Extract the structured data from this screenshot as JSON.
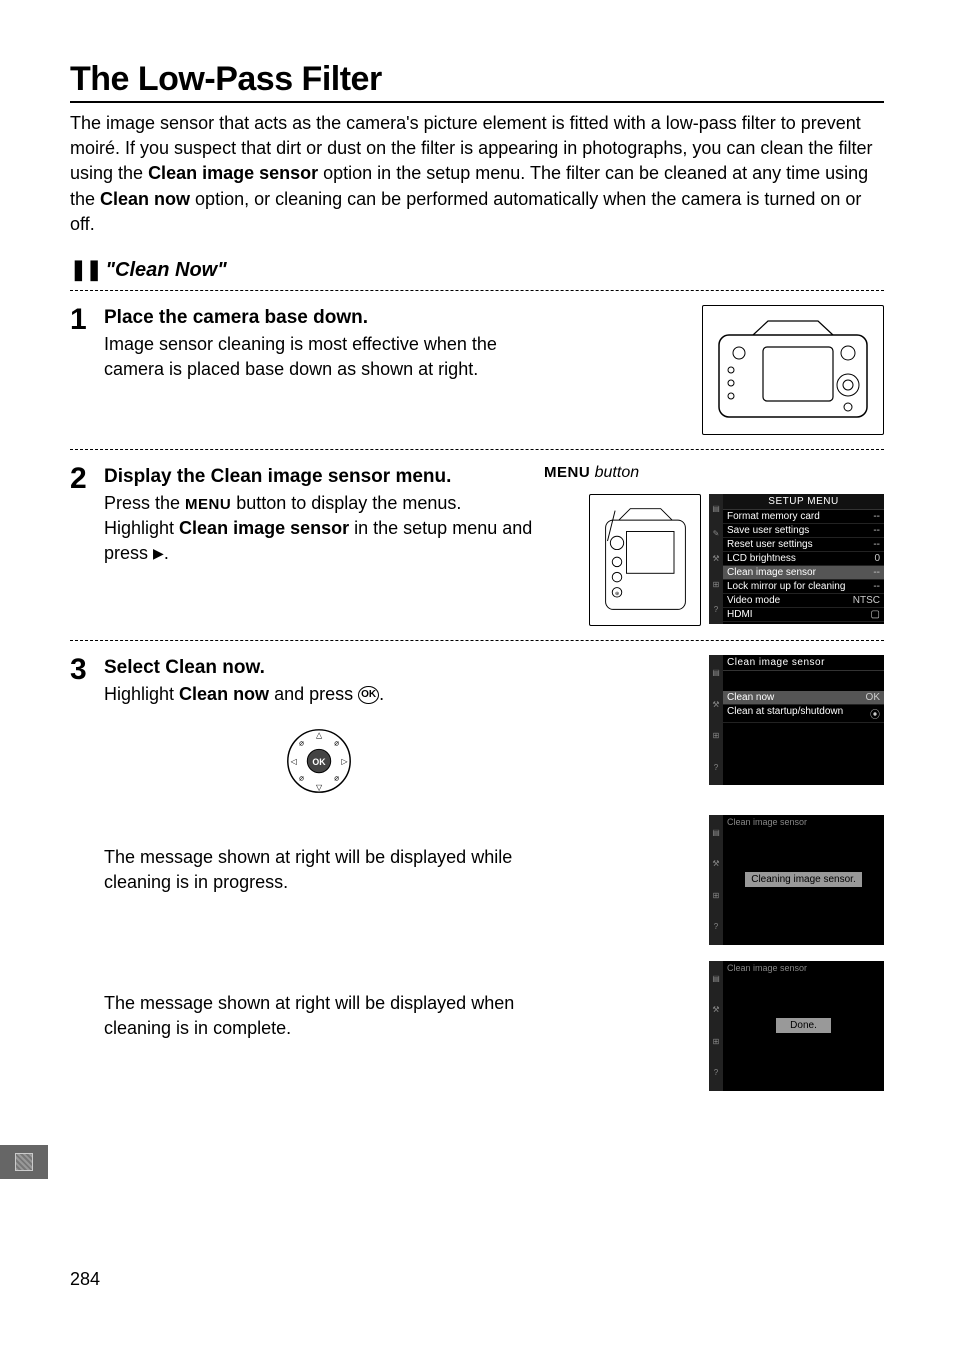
{
  "title": "The Low-Pass Filter",
  "intro_parts": {
    "p1a": "The image sensor that acts as the camera's picture element is fitted with a low-pass filter to prevent moiré. If you suspect that dirt or dust on the filter is appearing in photographs, you can clean the filter using the ",
    "p1b": "Clean image sensor",
    "p1c": " option in the setup menu. The filter can be cleaned at any time using the ",
    "p1d": "Clean now",
    "p1e": " option, or cleaning can be performed automatically when the camera is turned on or off."
  },
  "subhead": {
    "bars": "❚❚",
    "text": "\"Clean Now\""
  },
  "steps": {
    "s1": {
      "num": "1",
      "title": "Place the camera base down.",
      "body": "Image sensor cleaning is most effective when the camera is placed base down as shown at right."
    },
    "s2": {
      "num": "2",
      "title_a": "Display the ",
      "title_b": "Clean image sensor",
      "title_c": " menu.",
      "body_a": "Press the ",
      "body_menu": "MENU",
      "body_b": " button to display the menus. Highlight ",
      "body_c": "Clean image sensor",
      "body_d": " in the setup menu and press ",
      "body_e": "."
    },
    "s3": {
      "num": "3",
      "title_a": "Select ",
      "title_b": "Clean now",
      "title_c": ".",
      "body_a": "Highlight ",
      "body_b": "Clean now",
      "body_c": " and press ",
      "body_d": ".",
      "follow1": "The message shown at right will be displayed while cleaning is in progress.",
      "follow2": "The message shown at right will be displayed when cleaning is in complete."
    }
  },
  "menu_button_label": {
    "menu": "MENU",
    "button": "button"
  },
  "setup_menu": {
    "title": "SETUP MENU",
    "rows": [
      {
        "label": "Format memory card",
        "val": "--"
      },
      {
        "label": "Save user settings",
        "val": "--"
      },
      {
        "label": "Reset user settings",
        "val": "--"
      },
      {
        "label": "LCD brightness",
        "val": "0"
      },
      {
        "label": "Clean image sensor",
        "val": "--",
        "hl": true
      },
      {
        "label": "Lock mirror up for cleaning",
        "val": "--"
      },
      {
        "label": "Video mode",
        "val": "NTSC"
      },
      {
        "label": "HDMI",
        "val": "▢"
      }
    ]
  },
  "clean_menu": {
    "title": "Clean image sensor",
    "rows": [
      {
        "label": "Clean now",
        "val": "OK",
        "hl": true
      },
      {
        "label": "Clean at startup/shutdown",
        "val": "⦿"
      }
    ]
  },
  "progress_screen": {
    "top": "Clean image sensor",
    "msg": "Cleaning image sensor."
  },
  "done_screen": {
    "top": "Clean image sensor",
    "msg": "Done."
  },
  "page_number": "284"
}
